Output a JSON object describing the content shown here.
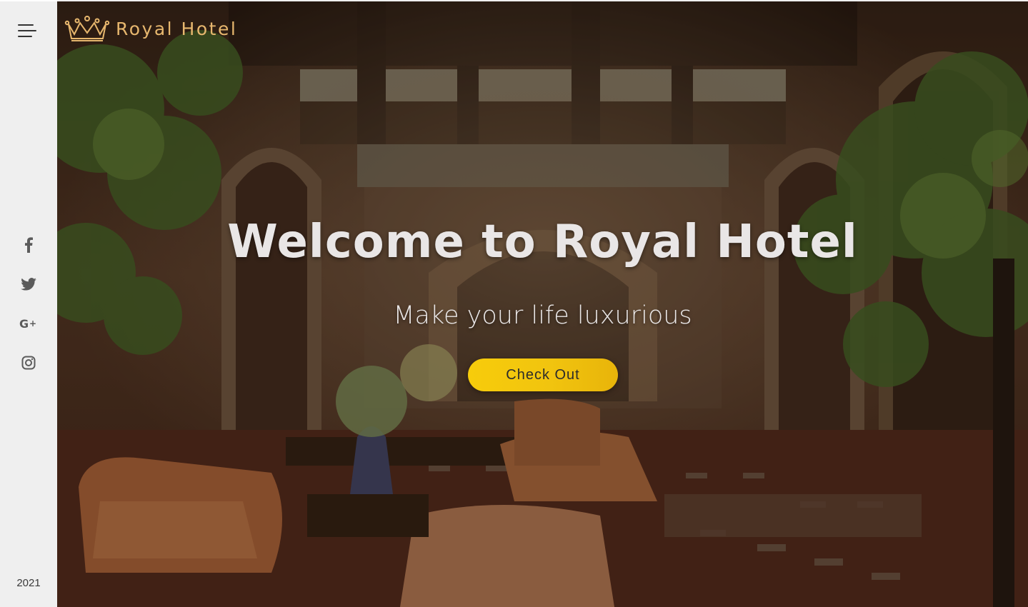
{
  "brand": {
    "name": "Royal Hotel",
    "logo_icon": "crown-icon",
    "color": "#e7b76e"
  },
  "sidebar": {
    "menu_icon": "hamburger-menu-icon",
    "socials": [
      {
        "name": "facebook-icon",
        "glyph": "f"
      },
      {
        "name": "twitter-icon",
        "glyph": ""
      },
      {
        "name": "google-plus-icon",
        "glyph": "G+"
      },
      {
        "name": "instagram-icon",
        "glyph": ""
      }
    ],
    "year": "2021"
  },
  "hero": {
    "title": "Welcome to Royal Hotel",
    "subtitle": "Make your life luxurious",
    "cta_label": "Check Out",
    "cta_color": "#f1c40f",
    "background": "hotel-lobby-photo"
  }
}
